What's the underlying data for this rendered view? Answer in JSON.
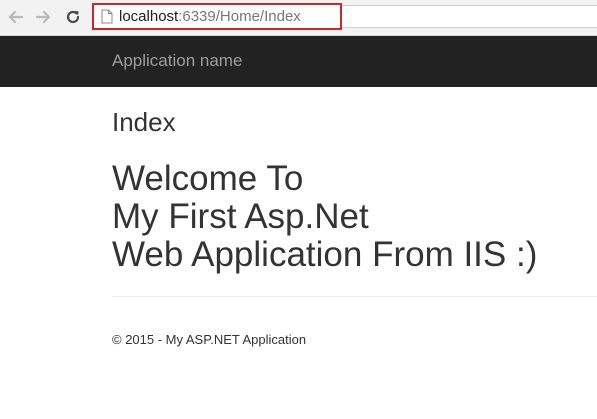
{
  "browser": {
    "url_host": "localhost",
    "url_path": ":6339/Home/Index",
    "icons": {
      "back": "back-arrow-icon",
      "forward": "forward-arrow-icon",
      "reload": "reload-icon",
      "page": "page-icon"
    },
    "highlight_color": "#d0262b"
  },
  "navbar": {
    "brand": "Application name",
    "background": "#222222"
  },
  "main": {
    "title": "Index",
    "welcome_lines": [
      "Welcome To",
      "My First Asp.Net",
      "Web Application From IIS :)"
    ]
  },
  "footer": {
    "text": "© 2015 - My ASP.NET Application"
  }
}
